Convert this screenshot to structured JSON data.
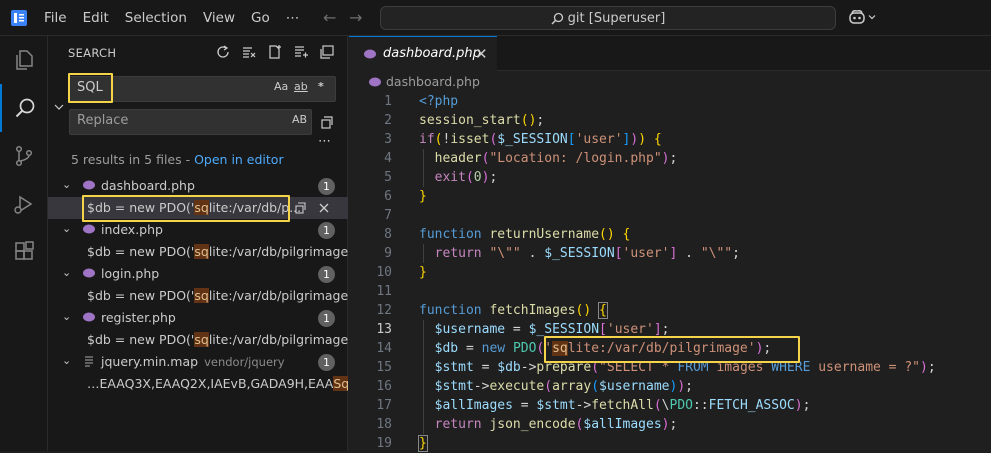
{
  "menu": [
    "File",
    "Edit",
    "Selection",
    "View",
    "Go",
    "⋯"
  ],
  "command_center": {
    "text": "git [Superuser]"
  },
  "sidebar": {
    "title": "SEARCH",
    "search_value": "SQL",
    "search_options": [
      "Aa",
      "ab",
      "*"
    ],
    "replace_placeholder": "Replace",
    "replace_option": "AB",
    "more": "⋯",
    "summary_text": "5 results in 5 files - ",
    "open_in_editor": "Open in editor",
    "files": [
      {
        "name": "dashboard.php",
        "count": "1",
        "match_pre": "$db = new PDO('",
        "match_hl": "sq",
        "match_post": "lite:/var/db/p..."
      },
      {
        "name": "index.php",
        "count": "1",
        "match_pre": "$db = new PDO('",
        "match_hl": "sq",
        "match_post": "lite:/var/db/pilgrimage');"
      },
      {
        "name": "login.php",
        "count": "1",
        "match_pre": "$db = new PDO('",
        "match_hl": "sq",
        "match_post": "lite:/var/db/pilgrimage');"
      },
      {
        "name": "register.php",
        "count": "1",
        "match_pre": "$db = new PDO('",
        "match_hl": "sq",
        "match_post": "lite:/var/db/pilgrimage');"
      },
      {
        "name": "jquery.min.map",
        "dir": "vendor/jquery",
        "count": "1",
        "match_pre": "…EAAQ3X,EAAQ2X,IAEvB,GADA9H,EAA",
        "match_hl": "Sq",
        "match_post": "…"
      }
    ]
  },
  "editor": {
    "tab_label": "dashboard.php",
    "breadcrumb": "dashboard.php",
    "line_numbers": [
      "1",
      "2",
      "3",
      "4",
      "5",
      "6",
      "7",
      "8",
      "9",
      "10",
      "11",
      "12",
      "13",
      "14",
      "15",
      "16",
      "17",
      "18",
      "19"
    ],
    "current_line": "13"
  },
  "colors": {
    "accent": "#0078d4",
    "highlight_box": "#f5d44a",
    "match_bg": "#613214"
  },
  "icons": [
    "app-logo-icon",
    "back-arrow-icon",
    "forward-arrow-icon",
    "search-icon",
    "copilot-icon",
    "explorer-icon",
    "search-view-icon",
    "source-control-icon",
    "run-debug-icon",
    "extensions-icon",
    "refresh-icon",
    "clear-results-icon",
    "new-search-editor-icon",
    "collapse-all-icon",
    "php-file-icon",
    "replace-all-icon",
    "close-icon"
  ]
}
